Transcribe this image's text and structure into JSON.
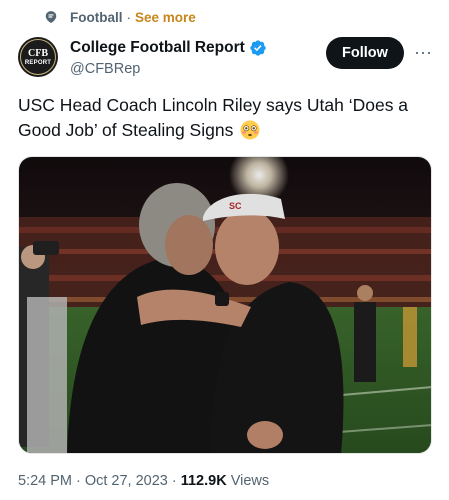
{
  "topic": {
    "name": "Football",
    "separator": "·",
    "see_more": "See more"
  },
  "author": {
    "avatar_text_top": "CFB",
    "avatar_text_bottom": "REPORT",
    "display_name": "College Football Report",
    "handle": "@CFBRep",
    "verified": true
  },
  "actions": {
    "follow_label": "Follow",
    "more_label": "···"
  },
  "tweet": {
    "text": "USC Head Coach Lincoln Riley says Utah ‘Does a Good Job’ of Stealing Signs",
    "emoji": "flushed-face",
    "media": {
      "description_icon": "photo",
      "visor_text": "SC"
    }
  },
  "meta": {
    "time": "5:24 PM",
    "separator": "·",
    "date": "Oct 27, 2023",
    "views_count": "112.9K",
    "views_label": "Views"
  },
  "colors": {
    "see_more": "#c8861c",
    "verified": "#1d9bf0",
    "follow_bg": "#0f1419",
    "secondary_text": "#536471"
  }
}
